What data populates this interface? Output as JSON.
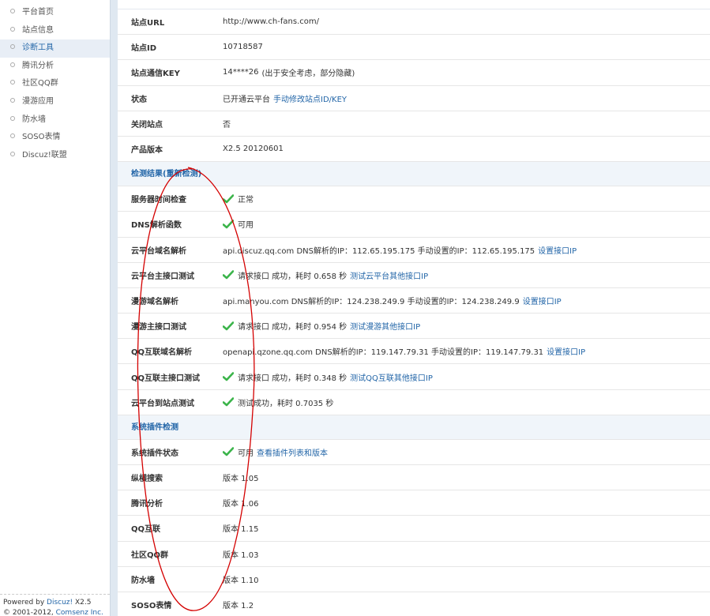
{
  "sidebar": {
    "items": [
      {
        "label": "平台首页",
        "active": false
      },
      {
        "label": "站点信息",
        "active": false
      },
      {
        "label": "诊断工具",
        "active": true
      },
      {
        "label": "腾讯分析",
        "active": false
      },
      {
        "label": "社区QQ群",
        "active": false
      },
      {
        "label": "漫游应用",
        "active": false
      },
      {
        "label": "防水墙",
        "active": false
      },
      {
        "label": "SOSO表情",
        "active": false
      },
      {
        "label": "Discuz!联盟",
        "active": false
      }
    ],
    "footer": {
      "powered_prefix": "Powered by ",
      "powered_link": "Discuz!",
      "powered_version": " X2.5",
      "copyright_prefix": "© 2001-2012, ",
      "copyright_link": "Comsenz Inc."
    }
  },
  "site_info": {
    "url_label": "站点URL",
    "url_value": "http://www.ch-fans.com/",
    "id_label": "站点ID",
    "id_value": "10718587",
    "key_label": "站点通信KEY",
    "key_value": "14****26",
    "key_note": "(出于安全考虑，部分隐藏)",
    "status_label": "状态",
    "status_value": "已开通云平台",
    "status_link": "手动修改站点ID/KEY",
    "closed_label": "关闭站点",
    "closed_value": "否",
    "version_label": "产品版本",
    "version_value": "X2.5 20120601"
  },
  "check_section": {
    "title": "检测结果(重新检测)"
  },
  "checks": {
    "time_label": "服务器时间检查",
    "time_value": "正常",
    "dns_label": "DNS解析函数",
    "dns_value": "可用",
    "cloud_dns_label": "云平台域名解析",
    "cloud_dns_value": "api.discuz.qq.com DNS解析的IP：112.65.195.175 手动设置的IP：112.65.195.175",
    "cloud_dns_link": "设置接口IP",
    "cloud_api_label": "云平台主接口测试",
    "cloud_api_value": "请求接口 成功，耗时 0.658 秒",
    "cloud_api_link": "测试云平台其他接口IP",
    "manyou_dns_label": "漫游域名解析",
    "manyou_dns_value": "api.manyou.com DNS解析的IP：124.238.249.9 手动设置的IP：124.238.249.9",
    "manyou_dns_link": "设置接口IP",
    "manyou_api_label": "漫游主接口测试",
    "manyou_api_value": "请求接口 成功，耗时 0.954 秒",
    "manyou_api_link": "测试漫游其他接口IP",
    "qq_dns_label": "QQ互联域名解析",
    "qq_dns_value": "openapi.qzone.qq.com DNS解析的IP：119.147.79.31 手动设置的IP：119.147.79.31",
    "qq_dns_link": "设置接口IP",
    "qq_api_label": "QQ互联主接口测试",
    "qq_api_value": "请求接口 成功，耗时 0.348 秒",
    "qq_api_link": "测试QQ互联其他接口IP",
    "cloud_site_label": "云平台到站点测试",
    "cloud_site_value": "测试成功，耗时 0.7035 秒"
  },
  "plugin_section": {
    "title": "系统插件检测"
  },
  "plugins": {
    "status_label": "系统插件状态",
    "status_value": "可用",
    "status_link": "查看插件列表和版本",
    "search_label": "纵横搜索",
    "search_value": "版本 1.05",
    "analysis_label": "腾讯分析",
    "analysis_value": "版本 1.06",
    "connect_label": "QQ互联",
    "connect_value": "版本 1.15",
    "qqgroup_label": "社区QQ群",
    "qqgroup_value": "版本 1.03",
    "firewall_label": "防水墙",
    "firewall_value": "版本 1.10",
    "soso_label": "SOSO表情",
    "soso_value": "版本 1.2"
  },
  "colors": {
    "accent": "#2366a8",
    "check": "#3bb44a",
    "annotation": "#d40000"
  }
}
